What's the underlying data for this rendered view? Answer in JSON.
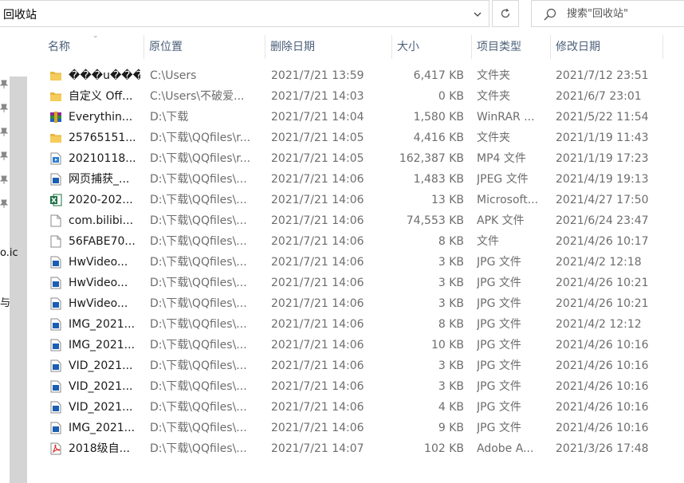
{
  "address": {
    "path": "回收站"
  },
  "search": {
    "placeholder": "搜索\"回收站\""
  },
  "nav": {
    "fragments": [
      "o.ic",
      "与 "
    ]
  },
  "columns": {
    "name": "名称",
    "location": "原位置",
    "deleted": "删除日期",
    "size": "大小",
    "type": "项目类型",
    "modified": "修改日期"
  },
  "icon_colors": {
    "folder": "#e8b740",
    "jpg": "#1a5fb4",
    "excel": "#1d7044",
    "pdf": "#d62b2b",
    "winrar": "#8b2a8f"
  },
  "rows": [
    {
      "icon": "folder-icon",
      "name": "���u���",
      "location": "C:\\Users",
      "deleted": "2021/7/21 13:59",
      "size": "6,417 KB",
      "type": "文件夹",
      "modified": "2021/7/12 23:51"
    },
    {
      "icon": "folder-icon",
      "name": "自定义 Off...",
      "location": "C:\\Users\\不破爱...",
      "deleted": "2021/7/21 14:03",
      "size": "0 KB",
      "type": "文件夹",
      "modified": "2021/6/7 23:01"
    },
    {
      "icon": "winrar-icon",
      "name": "Everythin...",
      "location": "D:\\下载",
      "deleted": "2021/7/21 14:04",
      "size": "1,580 KB",
      "type": "WinRAR ...",
      "modified": "2021/5/22 11:54"
    },
    {
      "icon": "folder-icon",
      "name": "25765151...",
      "location": "D:\\下载\\QQfiles\\r...",
      "deleted": "2021/7/21 14:05",
      "size": "4,416 KB",
      "type": "文件夹",
      "modified": "2021/1/19 11:43"
    },
    {
      "icon": "video-icon",
      "name": "20210118...",
      "location": "D:\\下载\\QQfiles\\r...",
      "deleted": "2021/7/21 14:05",
      "size": "162,387 KB",
      "type": "MP4 文件",
      "modified": "2021/1/19 17:23"
    },
    {
      "icon": "image-icon",
      "name": "网页捕获_...",
      "location": "D:\\下载\\QQfiles\\...",
      "deleted": "2021/7/21 14:06",
      "size": "1,483 KB",
      "type": "JPEG 文件",
      "modified": "2021/4/19 19:13"
    },
    {
      "icon": "excel-icon",
      "name": "2020-202...",
      "location": "D:\\下载\\QQfiles\\...",
      "deleted": "2021/7/21 14:06",
      "size": "13 KB",
      "type": "Microsoft...",
      "modified": "2021/4/27 17:50"
    },
    {
      "icon": "file-icon",
      "name": "com.bilibi...",
      "location": "D:\\下载\\QQfiles\\...",
      "deleted": "2021/7/21 14:06",
      "size": "74,553 KB",
      "type": "APK 文件",
      "modified": "2021/6/24 23:47"
    },
    {
      "icon": "file-icon",
      "name": "56FABE70...",
      "location": "D:\\下载\\QQfiles\\...",
      "deleted": "2021/7/21 14:06",
      "size": "8 KB",
      "type": "文件",
      "modified": "2021/4/26 10:17"
    },
    {
      "icon": "image-icon",
      "name": "HwVideo...",
      "location": "D:\\下载\\QQfiles\\...",
      "deleted": "2021/7/21 14:06",
      "size": "3 KB",
      "type": "JPG 文件",
      "modified": "2021/4/2 12:18"
    },
    {
      "icon": "image-icon",
      "name": "HwVideo...",
      "location": "D:\\下载\\QQfiles\\...",
      "deleted": "2021/7/21 14:06",
      "size": "3 KB",
      "type": "JPG 文件",
      "modified": "2021/4/26 10:21"
    },
    {
      "icon": "image-icon",
      "name": "HwVideo...",
      "location": "D:\\下载\\QQfiles\\...",
      "deleted": "2021/7/21 14:06",
      "size": "3 KB",
      "type": "JPG 文件",
      "modified": "2021/4/26 10:21"
    },
    {
      "icon": "image-icon",
      "name": "IMG_2021...",
      "location": "D:\\下载\\QQfiles\\...",
      "deleted": "2021/7/21 14:06",
      "size": "8 KB",
      "type": "JPG 文件",
      "modified": "2021/4/2 12:12"
    },
    {
      "icon": "image-icon",
      "name": "IMG_2021...",
      "location": "D:\\下载\\QQfiles\\...",
      "deleted": "2021/7/21 14:06",
      "size": "10 KB",
      "type": "JPG 文件",
      "modified": "2021/4/26 10:16"
    },
    {
      "icon": "image-icon",
      "name": "VID_2021...",
      "location": "D:\\下载\\QQfiles\\...",
      "deleted": "2021/7/21 14:06",
      "size": "3 KB",
      "type": "JPG 文件",
      "modified": "2021/4/26 10:16"
    },
    {
      "icon": "image-icon",
      "name": "VID_2021...",
      "location": "D:\\下载\\QQfiles\\...",
      "deleted": "2021/7/21 14:06",
      "size": "3 KB",
      "type": "JPG 文件",
      "modified": "2021/4/26 10:16"
    },
    {
      "icon": "image-icon",
      "name": "VID_2021...",
      "location": "D:\\下载\\QQfiles\\...",
      "deleted": "2021/7/21 14:06",
      "size": "4 KB",
      "type": "JPG 文件",
      "modified": "2021/4/26 10:16"
    },
    {
      "icon": "image-icon",
      "name": "IMG_2021...",
      "location": "D:\\下载\\QQfiles\\...",
      "deleted": "2021/7/21 14:06",
      "size": "9 KB",
      "type": "JPG 文件",
      "modified": "2021/4/26 10:16"
    },
    {
      "icon": "pdf-icon",
      "name": "2018级自...",
      "location": "D:\\下载\\QQfiles\\...",
      "deleted": "2021/7/21 14:07",
      "size": "102 KB",
      "type": "Adobe A...",
      "modified": "2021/3/26 17:48"
    }
  ]
}
